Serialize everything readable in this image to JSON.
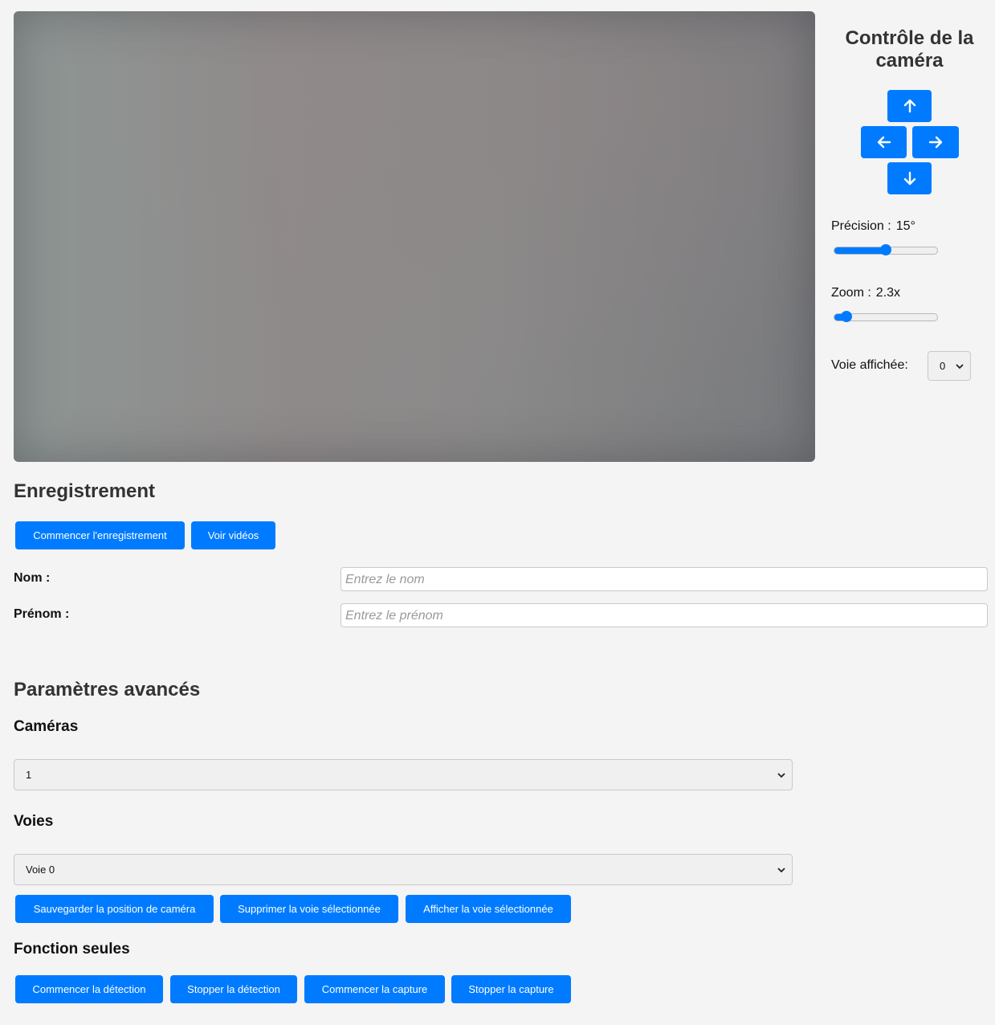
{
  "camera_control": {
    "title": "Contrôle de la caméra",
    "precision_label": "Précision :",
    "precision_value": "15°",
    "precision_slider_fraction": 0.5,
    "zoom_label": "Zoom :",
    "zoom_value": "2.3x",
    "zoom_slider_fraction": 0.12,
    "lane_label": "Voie affichée:",
    "lane_value": "0"
  },
  "recording": {
    "heading": "Enregistrement",
    "start_button": "Commencer l'enregistrement",
    "videos_button": "Voir vidéos",
    "name_label": "Nom :",
    "name_placeholder": "Entrez le nom",
    "firstname_label": "Prénom :",
    "firstname_placeholder": "Entrez le prénom"
  },
  "advanced": {
    "heading": "Paramètres avancés",
    "cameras_heading": "Caméras",
    "cameras_value": "1",
    "lanes_heading": "Voies",
    "lanes_value": "Voie 0",
    "save_position_button": "Sauvegarder la position de caméra",
    "delete_lane_button": "Supprimer la voie sélectionnée",
    "show_lane_button": "Afficher la voie sélectionnée",
    "functions_heading": "Fonction seules",
    "start_detection_button": "Commencer la détection",
    "stop_detection_button": "Stopper la détection",
    "start_capture_button": "Commencer la capture",
    "stop_capture_button": "Stopper la capture"
  },
  "colors": {
    "accent": "#007bff",
    "background": "#f4f4f4"
  }
}
